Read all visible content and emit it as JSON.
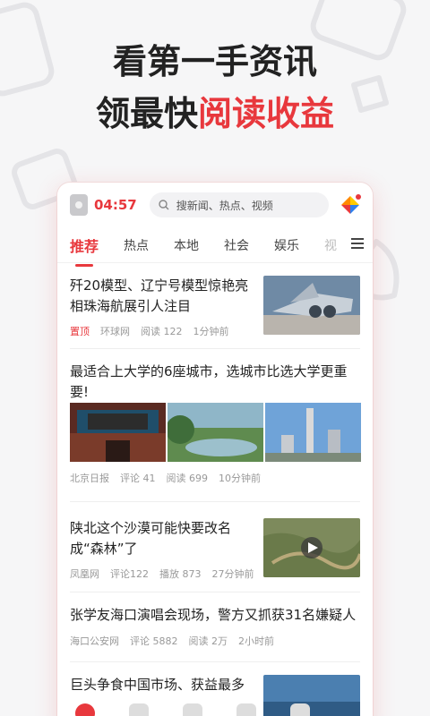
{
  "hero": {
    "line1": "看第一手资讯",
    "line2_prefix": "领最快",
    "line2_accent": "阅读收益"
  },
  "topbar": {
    "time": "04:57",
    "search_placeholder": "搜新闻、热点、视频"
  },
  "tabs": [
    "推荐",
    "热点",
    "本地",
    "社会",
    "娱乐",
    "视"
  ],
  "feed": [
    {
      "title": "歼20模型、辽宁号模型惊艳亮相珠海航展引人注目",
      "tag": "置顶",
      "source": "环球网",
      "stat1": "阅读 122",
      "stat2": "",
      "time": "1分钟前"
    },
    {
      "title": "最适合上大学的6座城市，选城市比选大学更重要!",
      "source": "北京日报",
      "stat1": "评论 41",
      "stat2": "阅读 699",
      "time": "10分钟前"
    },
    {
      "title": "陕北这个沙漠可能快要改名成“森林”了",
      "source": "凤凰网",
      "stat1": "评论122",
      "stat2": "播放 873",
      "time": "27分钟前"
    },
    {
      "title": "张学友海口演唱会现场，警方又抓获31名嫌疑人",
      "source": "海口公安网",
      "stat1": "评论 5882",
      "stat2": "阅读 2万",
      "time": "2小时前"
    },
    {
      "title": "巨头争食中国市场、获益最多"
    }
  ],
  "colors": {
    "accent": "#e8383d"
  },
  "icons": [
    "search-icon",
    "menu-icon",
    "play-icon",
    "app-logo-icon"
  ]
}
